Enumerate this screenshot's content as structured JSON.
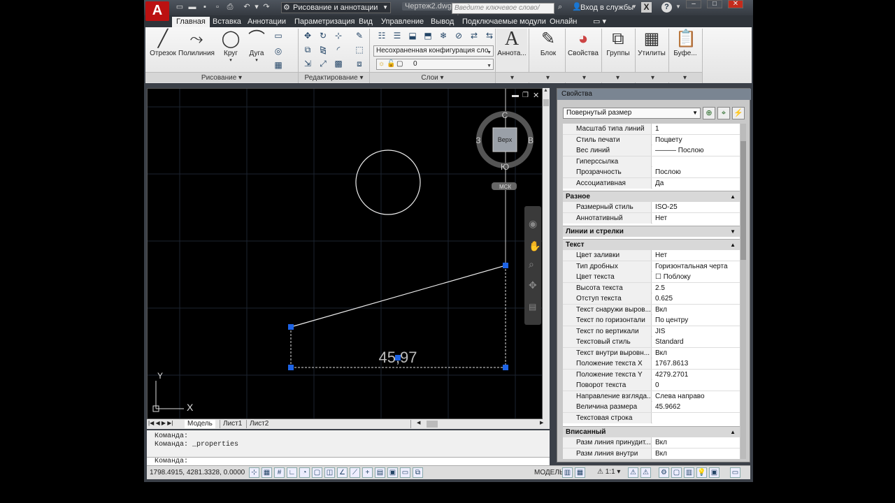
{
  "titlebar": {
    "workspace": "Рисование и аннотации",
    "doc_title": "Чертеж2.dwg",
    "search_placeholder": "Введите ключевое слово/фразу",
    "login": "Вход в службы",
    "help": "?"
  },
  "tabs": [
    "Главная",
    "Вставка",
    "Аннотации",
    "Параметризация",
    "Вид",
    "Управление",
    "Вывод",
    "Подключаемые модули",
    "Онлайн"
  ],
  "ribbon": {
    "draw_tools": [
      "Отрезок",
      "Полилиния",
      "Круг",
      "Дуга"
    ],
    "panels": [
      "Рисование",
      "Редактирование",
      "Слои"
    ],
    "layer_config": "Несохраненная конфигурация сло",
    "current_layer": "0",
    "right_tools": [
      "Аннота...",
      "Блок",
      "Свойства",
      "Группы",
      "Утилиты",
      "Буфе..."
    ]
  },
  "viewcube": {
    "n": "С",
    "s": "Ю",
    "w": "З",
    "e": "В",
    "face": "Верх",
    "ucs": "МСК"
  },
  "dimension_text": "45,97",
  "ucs_icon": {
    "x": "X",
    "y": "Y"
  },
  "layout_tabs": [
    "Модель",
    "Лист1",
    "Лист2"
  ],
  "command": {
    "history": [
      "Команда:",
      "Команда:  _properties"
    ],
    "prompt": "Команда:"
  },
  "status": {
    "coords": "1798.4915, 4281.3328, 0.0000",
    "model": "МОДЕЛЬ",
    "scale": "1:1"
  },
  "properties": {
    "title": "Свойства",
    "object_type": "Повернутый размер",
    "rows_top": [
      {
        "k": "Масштаб типа линий",
        "v": "1"
      },
      {
        "k": "Стиль печати",
        "v": "Поцвету"
      },
      {
        "k": "Вес линий",
        "v": "——— Послою"
      },
      {
        "k": "Гиперссылка",
        "v": ""
      },
      {
        "k": "Прозрачность",
        "v": "Послою"
      },
      {
        "k": "Ассоциативная",
        "v": "Да"
      }
    ],
    "cat_misc": "Разное",
    "rows_misc": [
      {
        "k": "Размерный стиль",
        "v": "ISO-25"
      },
      {
        "k": "Аннотативный",
        "v": "Нет"
      }
    ],
    "cat_lines": "Линии и стрелки",
    "cat_text": "Текст",
    "rows_text": [
      {
        "k": "Цвет заливки",
        "v": "Нет"
      },
      {
        "k": "Тип дробных",
        "v": "Горизонтальная черта"
      },
      {
        "k": "Цвет текста",
        "v": "☐ Поблоку"
      },
      {
        "k": "Высота текста",
        "v": "2.5"
      },
      {
        "k": "Отступ текста",
        "v": "0.625"
      },
      {
        "k": "Текст снаружи выров...",
        "v": "Вкл"
      },
      {
        "k": "Текст по горизонтали",
        "v": "По центру"
      },
      {
        "k": "Текст по вертикали",
        "v": "JIS"
      },
      {
        "k": "Текстовый стиль",
        "v": "Standard"
      },
      {
        "k": "Текст внутри выровн...",
        "v": "Вкл"
      },
      {
        "k": "Положение текста X",
        "v": "1767.8613"
      },
      {
        "k": "Положение текста Y",
        "v": "4279.2701"
      },
      {
        "k": "Поворот текста",
        "v": "0"
      },
      {
        "k": "Направление взгляда...",
        "v": "Слева направо"
      },
      {
        "k": "Величина размера",
        "v": "45.9662"
      },
      {
        "k": "Текстовая строка",
        "v": ""
      }
    ],
    "cat_fit": "Вписанный",
    "rows_fit": [
      {
        "k": "Разм линия принудит...",
        "v": "Вкл"
      },
      {
        "k": "Разм линия внутри",
        "v": "Вкл"
      }
    ]
  }
}
